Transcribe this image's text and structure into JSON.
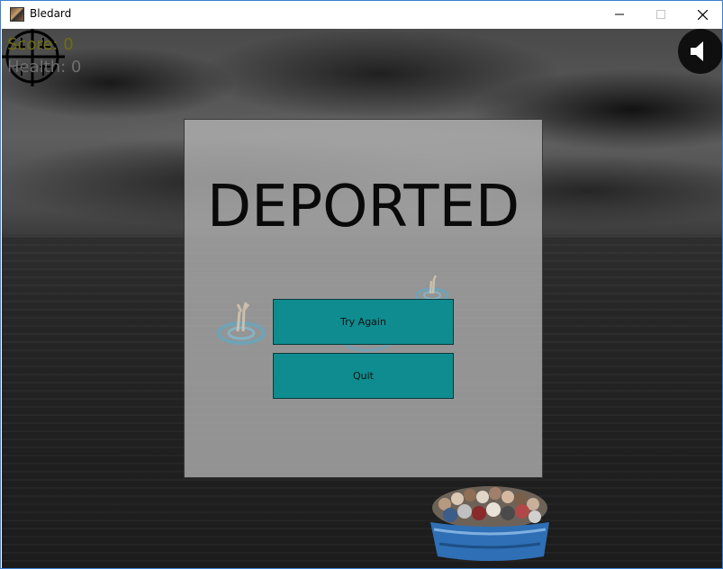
{
  "window": {
    "title": "Bledard",
    "minimize_icon": "minimize-icon",
    "maximize_icon": "maximize-icon",
    "close_icon": "close-icon"
  },
  "hud": {
    "score_label": "Score: 0",
    "health_label": "Health: 0",
    "crosshair_icon": "crosshair-icon",
    "sound_icon": "speaker-icon"
  },
  "dialog": {
    "title": "DEPORTED",
    "try_again_label": "Try Again",
    "quit_label": "Quit"
  },
  "colors": {
    "button": "#0f8c8f",
    "score": "#6f6d0f"
  }
}
